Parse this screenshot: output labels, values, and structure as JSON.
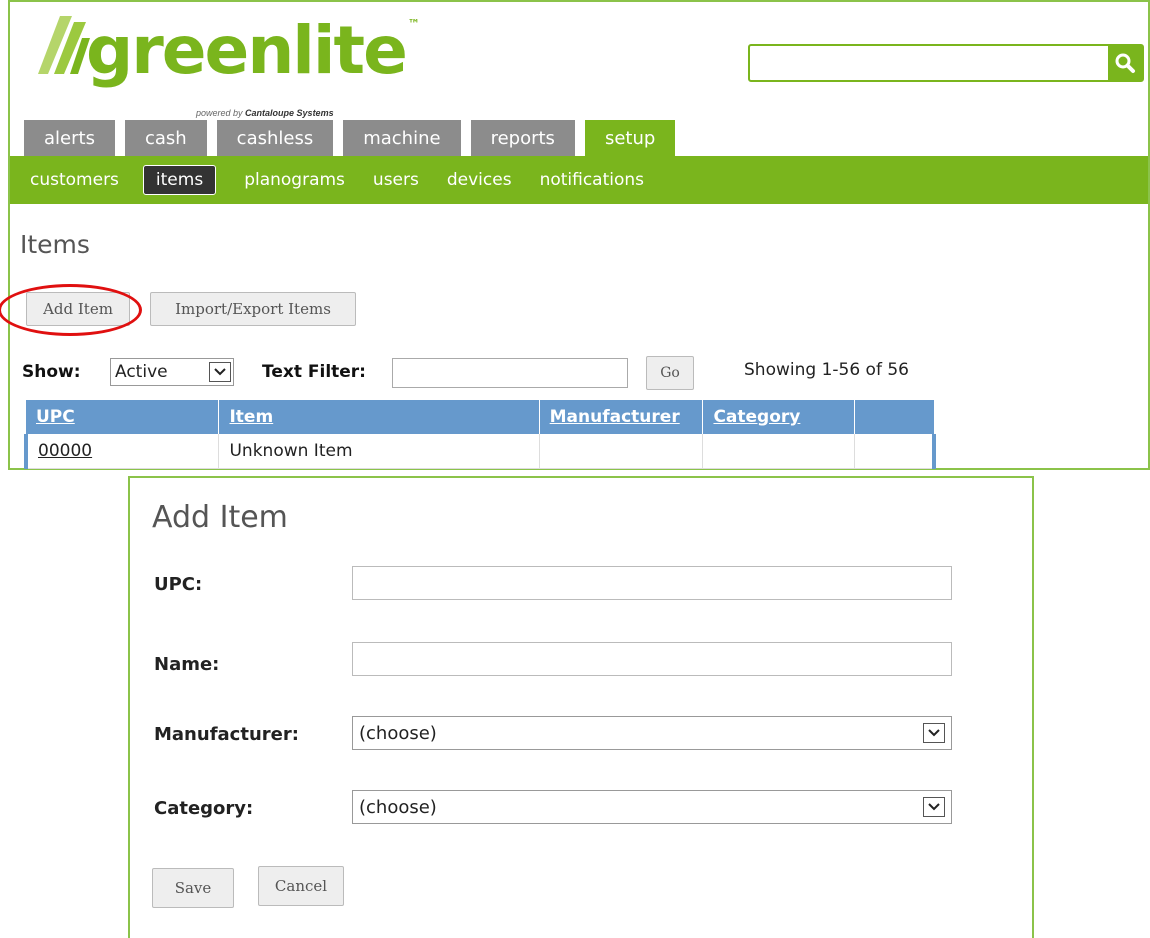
{
  "logo": {
    "name": "greenlite",
    "trademark": "™",
    "tagline_prefix": "powered by",
    "tagline_brand": "Cantaloupe Systems"
  },
  "search": {
    "placeholder": "",
    "icon": "search-icon"
  },
  "main_tabs": [
    "alerts",
    "cash",
    "cashless",
    "machine",
    "reports",
    "setup"
  ],
  "active_tab": "setup",
  "sub_nav": [
    "customers",
    "items",
    "planograms",
    "users",
    "devices",
    "notifications"
  ],
  "active_sub_nav": "items",
  "page": {
    "title": "Items"
  },
  "buttons": {
    "add_item": "Add Item",
    "import_export": "Import/Export Items",
    "go": "Go"
  },
  "filters": {
    "show_label": "Show:",
    "show_value": "Active",
    "text_filter_label": "Text Filter:",
    "text_filter_value": ""
  },
  "showing": "Showing 1-56 of 56",
  "table": {
    "headers": [
      "UPC",
      "Item",
      "Manufacturer",
      "Category",
      ""
    ],
    "rows": [
      {
        "upc": "00000",
        "item": "Unknown Item",
        "manufacturer": "",
        "category": "",
        "extra": ""
      }
    ]
  },
  "dialog": {
    "title": "Add Item",
    "upc_label": "UPC:",
    "name_label": "Name:",
    "manufacturer_label": "Manufacturer:",
    "manufacturer_value": "(choose)",
    "category_label": "Category:",
    "category_value": "(choose)",
    "save": "Save",
    "cancel": "Cancel"
  },
  "colors": {
    "brand_green": "#7ab51d",
    "tab_gray": "#8c8c8c",
    "table_header_blue": "#6699cc",
    "highlight_red": "#e01010"
  }
}
